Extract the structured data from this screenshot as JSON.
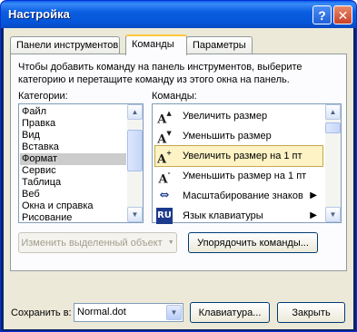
{
  "window": {
    "title": "Настройка"
  },
  "titlebar": {
    "help_label": "?",
    "close_label": "✕"
  },
  "tabs": [
    {
      "label": "Панели инструментов"
    },
    {
      "label": "Команды"
    },
    {
      "label": "Параметры"
    }
  ],
  "instructions": "Чтобы добавить команду на панель инструментов, выберите категорию и перетащите команду из этого окна на панель.",
  "categories": {
    "label": "Категории:",
    "items": [
      "Файл",
      "Правка",
      "Вид",
      "Вставка",
      "Формат",
      "Сервис",
      "Таблица",
      "Веб",
      "Окна и справка",
      "Рисование"
    ],
    "selected": "Формат"
  },
  "commands": {
    "label": "Команды:",
    "items": [
      {
        "label": "Увеличить размер",
        "icon": "grow-font-icon",
        "glyph": "A",
        "mark": "▲"
      },
      {
        "label": "Уменьшить размер",
        "icon": "shrink-font-icon",
        "glyph": "A",
        "mark": "▼"
      },
      {
        "label": "Увеличить размер на 1 пт",
        "icon": "grow-font-1pt-icon",
        "glyph": "A",
        "mark": "+"
      },
      {
        "label": "Уменьшить размер на 1 пт",
        "icon": "shrink-font-1pt-icon",
        "glyph": "A",
        "mark": "-"
      },
      {
        "label": "Масштабирование знаков",
        "icon": "char-scale-icon",
        "glyph": "⇔",
        "mark": "",
        "submenu": "▶"
      },
      {
        "label": "Язык клавиатуры",
        "icon": "keyboard-language-icon",
        "glyph": "RU",
        "mark": "",
        "submenu": "▶"
      }
    ],
    "selected": "Увеличить размер на 1 пт"
  },
  "buttons": {
    "modify_selection": "Изменить выделенный объект",
    "modify_arrow": "▼",
    "rearrange": "Упорядочить команды...",
    "keyboard": "Клавиатура...",
    "close": "Закрыть"
  },
  "save_in": {
    "label": "Сохранить в:",
    "value": "Normal.dot",
    "arrow": "▼"
  },
  "scroll_glyphs": {
    "up": "▲",
    "down": "▼"
  }
}
